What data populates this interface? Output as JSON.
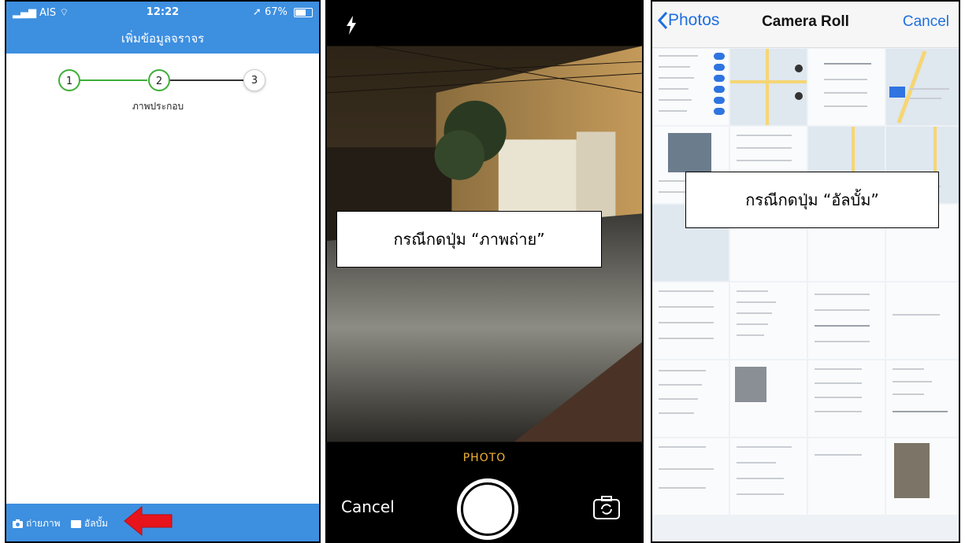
{
  "panel1": {
    "status": {
      "carrier": "AIS",
      "time": "12:22",
      "battery": "67%"
    },
    "header_title": "เพิ่มข้อมูลจราจร",
    "steps": [
      {
        "number": "1",
        "label": ""
      },
      {
        "number": "2",
        "label": "ภาพประกอบ"
      },
      {
        "number": "3",
        "label": ""
      }
    ],
    "bottom": {
      "camera_label": "ถ่ายภาพ",
      "album_label": "อัลบั้ม"
    },
    "colors": {
      "primary": "#3d8fe0",
      "step_active": "#3fae3a",
      "arrow": "#e8141b"
    }
  },
  "panel2": {
    "mode_label": "PHOTO",
    "cancel_label": "Cancel",
    "callout": "กรณีกดปุ่ม “ภาพถ่าย”",
    "colors": {
      "mode": "#f5b436"
    }
  },
  "panel3": {
    "nav": {
      "back_label": "Photos",
      "title": "Camera Roll",
      "cancel_label": "Cancel"
    },
    "callout": "กรณีกดปุ่ม “อัลบั้ม”",
    "colors": {
      "link": "#1e6fe0"
    }
  }
}
